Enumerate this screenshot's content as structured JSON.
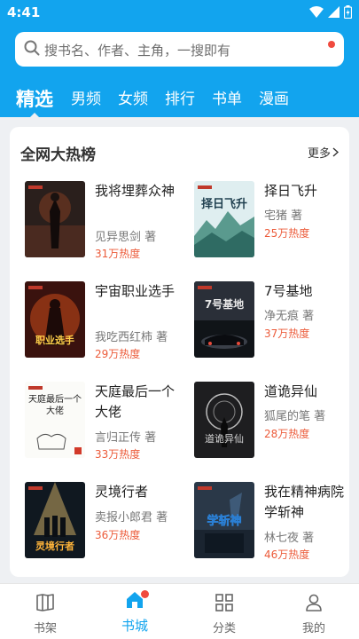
{
  "status": {
    "time": "4:41"
  },
  "search": {
    "placeholder": "搜书名、作者、主角，一搜即有"
  },
  "tabs": [
    {
      "label": "精选",
      "active": true
    },
    {
      "label": "男频"
    },
    {
      "label": "女频"
    },
    {
      "label": "排行"
    },
    {
      "label": "书单"
    },
    {
      "label": "漫画"
    }
  ],
  "section": {
    "title": "全网大热榜",
    "more_label": "更多"
  },
  "books": [
    {
      "title": "我将埋葬众神",
      "author": "见异思剑 著",
      "heat": "31万热度",
      "cover_text": ""
    },
    {
      "title": "择日飞升",
      "author": "宅猪 著",
      "heat": "25万热度",
      "cover_text": "择日飞升"
    },
    {
      "title": "宇宙职业选手",
      "author": "我吃西红柿 著",
      "heat": "29万热度",
      "cover_text": "职业选手"
    },
    {
      "title": "7号基地",
      "author": "净无痕 著",
      "heat": "37万热度",
      "cover_text": "7号基地"
    },
    {
      "title": "天庭最后一个大佬",
      "author": "言归正传 著",
      "heat": "33万热度",
      "cover_text": "天庭最后一个大佬"
    },
    {
      "title": "道诡异仙",
      "author": "狐尾的笔 著",
      "heat": "28万热度",
      "cover_text": "道诡异仙"
    },
    {
      "title": "灵境行者",
      "author": "卖报小郎君 著",
      "heat": "36万热度",
      "cover_text": "灵境行者"
    },
    {
      "title": "我在精神病院学斩神",
      "author": "林七夜 著",
      "heat": "46万热度",
      "cover_text": "学斩神"
    }
  ],
  "nav": [
    {
      "label": "书架",
      "icon": "bookshelf-icon"
    },
    {
      "label": "书城",
      "icon": "bookstore-icon",
      "active": true
    },
    {
      "label": "分类",
      "icon": "grid-icon"
    },
    {
      "label": "我的",
      "icon": "user-icon"
    }
  ],
  "colors": {
    "header": "#12a4ee",
    "accent": "#12a4ee",
    "heat": "#ec5b3a",
    "badge": "#f04a3e"
  }
}
